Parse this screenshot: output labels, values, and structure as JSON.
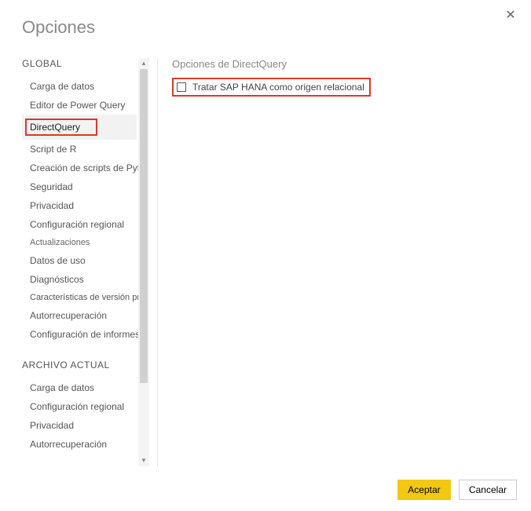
{
  "dialog": {
    "title": "Opciones"
  },
  "sidebar": {
    "section_global": "GLOBAL",
    "section_current": "ARCHIVO ACTUAL",
    "global_items": [
      "Carga de datos",
      "Editor de Power Query",
      "DirectQuery",
      "Script de R",
      "Creación de scripts de Python",
      "Seguridad",
      "Privacidad",
      "Configuración regional",
      "Actualizaciones",
      "Datos de uso",
      "Diagnósticos",
      "Características de versión preliminar",
      "Autorrecuperación",
      "Configuración de informes"
    ],
    "current_items": [
      "Carga de datos",
      "Configuración regional",
      "Privacidad",
      "Autorrecuperación"
    ],
    "selected": "DirectQuery"
  },
  "content": {
    "section_title": "Opciones de DirectQuery",
    "checkbox_label": "Tratar SAP HANA como origen relacional"
  },
  "footer": {
    "ok": "Aceptar",
    "cancel": "Cancelar"
  }
}
